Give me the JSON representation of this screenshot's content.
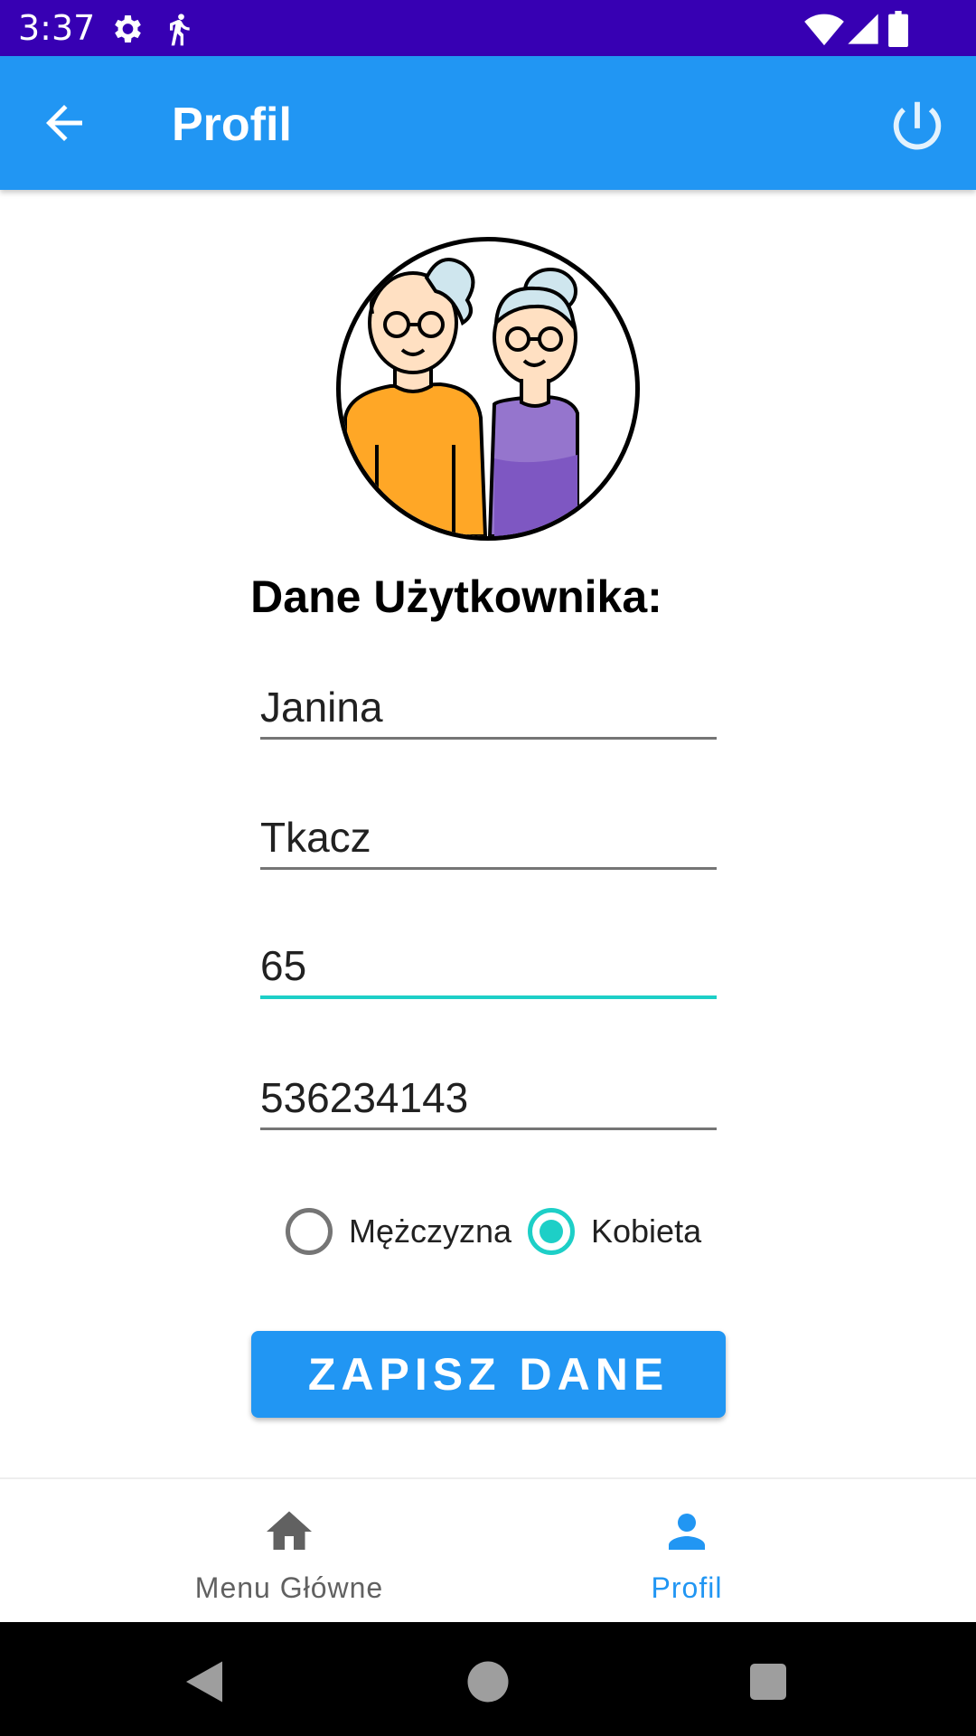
{
  "status_bar": {
    "time": "3:37",
    "icons": [
      "gear-icon",
      "walking-person-icon",
      "wifi-icon",
      "signal-icon",
      "battery-icon"
    ]
  },
  "app_bar": {
    "title": "Profil",
    "back_icon": "arrow-left-icon",
    "power_icon": "power-icon"
  },
  "profile": {
    "avatar": "elderly-couple-avatar",
    "heading": "Dane Użytkownika:",
    "first_name": "Janina",
    "last_name": "Tkacz",
    "age": "65",
    "phone": "536234143",
    "gender_options": [
      {
        "label": "Mężczyzna",
        "checked": false
      },
      {
        "label": "Kobieta",
        "checked": true
      }
    ],
    "save_label": "ZAPISZ DANE"
  },
  "bottom_nav": {
    "items": [
      {
        "label": "Menu Główne",
        "icon": "home-icon",
        "active": false
      },
      {
        "label": "Profil",
        "icon": "person-icon",
        "active": true
      }
    ]
  },
  "colors": {
    "status_bar": "#3700B3",
    "primary": "#2196F3",
    "accent": "#1DCFC7",
    "inactive_nav": "#616161",
    "system_bar": "#000000"
  },
  "system_nav": [
    "back-triangle-icon",
    "home-circle-icon",
    "recents-square-icon"
  ]
}
